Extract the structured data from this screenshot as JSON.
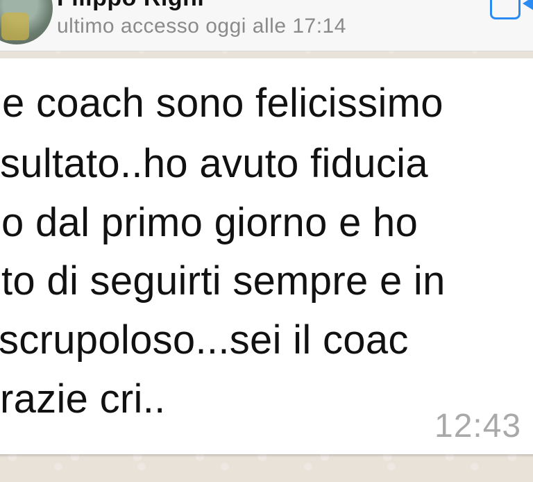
{
  "header": {
    "contact_name": "Filippo Righi",
    "last_seen": "ultimo accesso oggi alle 17:14",
    "video_call_icon": "video-call-icon"
  },
  "message": {
    "lines": [
      "e coach sono felicissimo",
      "sultato..ho avuto fiducia",
      "o dal primo giorno e ho",
      "to di seguirti sempre e in",
      " scrupoloso...sei il coac",
      "razie cri.."
    ],
    "time": "12:43"
  }
}
